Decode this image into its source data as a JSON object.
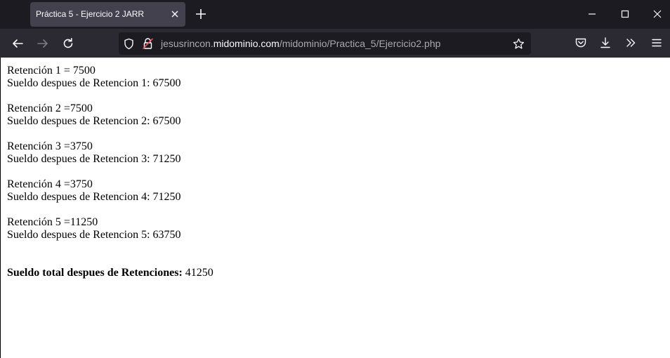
{
  "browser": {
    "tab_title": "Práctica 5 - Ejercicio 2 JARR",
    "url": {
      "prefix": "jesusrincon.",
      "domain": "midominio.com",
      "path": "/midominio/Practica_5/Ejercicio2.php"
    },
    "icons": {
      "back": "back-arrow-icon",
      "forward": "forward-arrow-icon",
      "reload": "reload-icon",
      "shield": "tracking-shield-icon",
      "lock": "insecure-lock-icon",
      "bookmark": "star-icon",
      "pocket": "pocket-icon",
      "downloads": "download-icon",
      "overflow": "chevrons-icon",
      "menu": "hamburger-menu-icon"
    }
  },
  "page": {
    "retenciones": [
      {
        "ret": "Retención 1 = 7500",
        "sueldo": "Sueldo despues de Retencion 1: 67500"
      },
      {
        "ret": "Retención 2 =7500",
        "sueldo": "Sueldo despues de Retencion 2: 67500"
      },
      {
        "ret": "Retención 3 =3750",
        "sueldo": "Sueldo despues de Retencion 3: 71250"
      },
      {
        "ret": "Retención 4 =3750",
        "sueldo": "Sueldo despues de Retencion 4: 71250"
      },
      {
        "ret": "Retención 5 =11250",
        "sueldo": "Sueldo despues de Retencion 5: 63750"
      }
    ],
    "total_label": "Sueldo total despues de Retenciones:",
    "total_value": " 41250"
  }
}
